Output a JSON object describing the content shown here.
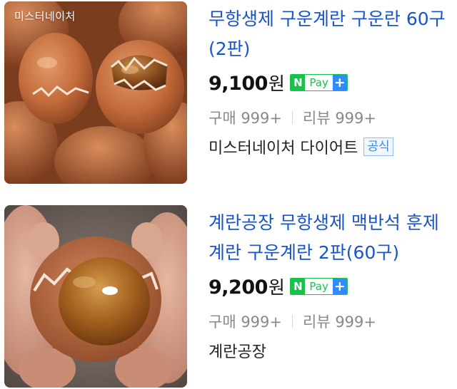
{
  "products": [
    {
      "image_watermark": "미스터네이처",
      "title": "무항생제 구운계란 구운란 60구(2판)",
      "price": "9,100",
      "currency": "원",
      "npay": {
        "n": "N",
        "pay": "Pay",
        "plus": "+"
      },
      "purchases": "구매 999+",
      "reviews": "리뷰 999+",
      "seller": "미스터네이처 다이어트",
      "badge": "공식"
    },
    {
      "title": "계란공장 무항생제 맥반석 훈제계란 구운계란 2판(60구)",
      "price": "9,200",
      "currency": "원",
      "npay": {
        "n": "N",
        "pay": "Pay",
        "plus": "+"
      },
      "purchases": "구매 999+",
      "reviews": "리뷰 999+",
      "seller": "계란공장"
    }
  ],
  "colors": {
    "title_link": "#1a55c6",
    "npay_green": "#19c34b",
    "npay_blue": "#2f8cff",
    "badge_blue": "#3a8be6"
  }
}
